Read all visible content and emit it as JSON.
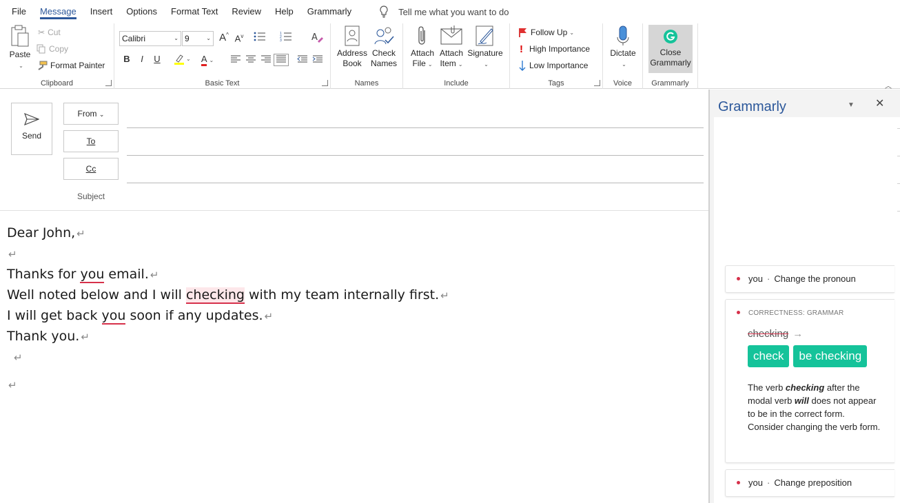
{
  "tabs": [
    "File",
    "Message",
    "Insert",
    "Options",
    "Format Text",
    "Review",
    "Help",
    "Grammarly"
  ],
  "active_tab": "Message",
  "tell_me": "Tell me what you want to do",
  "clipboard": {
    "paste": "Paste",
    "cut": "Cut",
    "copy": "Copy",
    "format_painter": "Format Painter",
    "label": "Clipboard"
  },
  "basic_text": {
    "font": "Calibri",
    "size": "9",
    "grow": "A",
    "shrink": "A",
    "bold": "B",
    "italic": "I",
    "underline": "U",
    "font_color_letter": "A",
    "label": "Basic Text"
  },
  "names": {
    "address_book_1": "Address",
    "address_book_2": "Book",
    "check_names_1": "Check",
    "check_names_2": "Names",
    "label": "Names"
  },
  "include": {
    "attach_file_1": "Attach",
    "attach_file_2": "File",
    "attach_item_1": "Attach",
    "attach_item_2": "Item",
    "signature": "Signature",
    "label": "Include"
  },
  "tags": {
    "follow_up": "Follow Up",
    "high": "High Importance",
    "low": "Low Importance",
    "label": "Tags"
  },
  "voice": {
    "dictate": "Dictate",
    "label": "Voice"
  },
  "grammarly_group": {
    "close_1": "Close",
    "close_2": "Grammarly",
    "label": "Grammarly"
  },
  "compose": {
    "send": "Send",
    "from": "From",
    "to": "To",
    "cc": "Cc",
    "subject": "Subject"
  },
  "body": {
    "l1": "Dear John,",
    "l2a": "Thanks for ",
    "l2err": "you",
    "l2b": " email.",
    "l3a": "Well noted below and I will ",
    "l3err": "checking",
    "l3b": " with my team internally first.",
    "l4a": "I will get back ",
    "l4err": "you",
    "l4b": " soon if any updates.",
    "l5": "Thank you.",
    "pilcrow": "↵"
  },
  "grammarly": {
    "title": "Grammarly",
    "card1_word": "you",
    "card1_desc": "Change the pronoun",
    "card2_category": "CORRECTNESS: GRAMMAR",
    "card2_original": "checking",
    "card2_arrow": "→",
    "card2_suggestions": [
      "check",
      "be checking"
    ],
    "card2_expl_1": "The verb ",
    "card2_expl_w1": "checking",
    "card2_expl_2": " after the modal verb ",
    "card2_expl_w2": "will",
    "card2_expl_3": " does not appear to be in the correct form. Consider changing the verb form.",
    "card3_word": "you",
    "card3_desc": "Change preposition",
    "separator": "·"
  },
  "colors": {
    "accent": "#2b579a",
    "error": "#d6304a",
    "suggest": "#15c39a"
  }
}
